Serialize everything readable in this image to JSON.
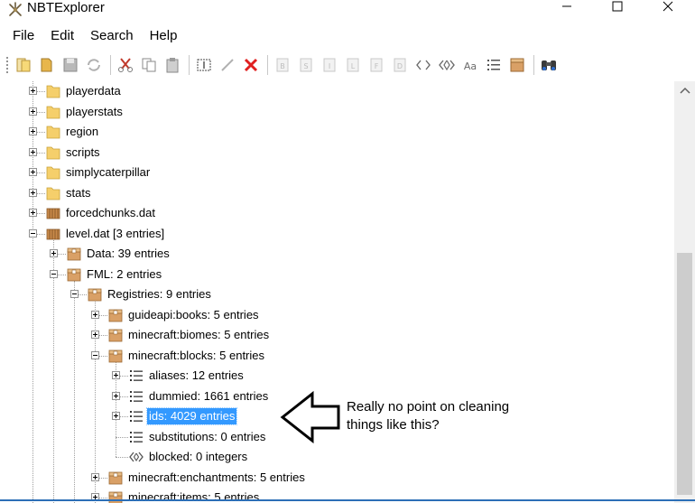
{
  "window": {
    "title": "NBTExplorer"
  },
  "menu": [
    "File",
    "Edit",
    "Search",
    "Help"
  ],
  "toolbar_icons": [
    "open-folder-icon",
    "open-file-icon",
    "save-icon",
    "refresh-icon",
    "cut-icon",
    "copy-icon",
    "paste-icon",
    "rename-icon",
    "edit-icon",
    "delete-icon",
    "add-byte-icon",
    "add-short-icon",
    "add-int-icon",
    "add-long-icon",
    "add-float-icon",
    "add-double-icon",
    "add-byte-array-icon",
    "add-int-array-icon",
    "add-string-icon",
    "add-list-icon",
    "add-compound-icon",
    "find-icon"
  ],
  "tree": [
    {
      "label": "playerdata",
      "icon": "folder-icon",
      "depth": 0,
      "expander": "plus"
    },
    {
      "label": "playerstats",
      "icon": "folder-icon",
      "depth": 0,
      "expander": "plus"
    },
    {
      "label": "region",
      "icon": "folder-icon",
      "depth": 0,
      "expander": "plus"
    },
    {
      "label": "scripts",
      "icon": "folder-icon",
      "depth": 0,
      "expander": "plus"
    },
    {
      "label": "simplycaterpillar",
      "icon": "folder-icon",
      "depth": 0,
      "expander": "plus"
    },
    {
      "label": "stats",
      "icon": "folder-icon",
      "depth": 0,
      "expander": "plus"
    },
    {
      "label": "forcedchunks.dat",
      "icon": "dat-file-icon",
      "depth": 0,
      "expander": "plus"
    },
    {
      "label": "level.dat [3 entries]",
      "icon": "dat-file-icon",
      "depth": 0,
      "expander": "minus"
    },
    {
      "label": "Data: 39 entries",
      "icon": "compound-tag-icon",
      "depth": 1,
      "expander": "plus"
    },
    {
      "label": "FML: 2 entries",
      "icon": "compound-tag-icon",
      "depth": 1,
      "expander": "minus"
    },
    {
      "label": "Registries: 9 entries",
      "icon": "compound-tag-icon",
      "depth": 2,
      "expander": "minus"
    },
    {
      "label": "guideapi:books: 5 entries",
      "icon": "compound-tag-icon",
      "depth": 3,
      "expander": "plus"
    },
    {
      "label": "minecraft:biomes: 5 entries",
      "icon": "compound-tag-icon",
      "depth": 3,
      "expander": "plus"
    },
    {
      "label": "minecraft:blocks: 5 entries",
      "icon": "compound-tag-icon",
      "depth": 3,
      "expander": "minus"
    },
    {
      "label": "aliases: 12 entries",
      "icon": "list-tag-icon",
      "depth": 4,
      "expander": "plus"
    },
    {
      "label": "dummied: 1661 entries",
      "icon": "list-tag-icon",
      "depth": 4,
      "expander": "plus"
    },
    {
      "label": "ids: 4029 entries",
      "icon": "list-tag-icon",
      "depth": 4,
      "expander": "plus",
      "selected": true
    },
    {
      "label": "substitutions: 0 entries",
      "icon": "list-tag-icon",
      "depth": 4,
      "expander": "none"
    },
    {
      "label": "blocked: 0 integers",
      "icon": "int-array-tag-icon",
      "depth": 4,
      "expander": "none"
    },
    {
      "label": "minecraft:enchantments: 5 entries",
      "icon": "compound-tag-icon",
      "depth": 3,
      "expander": "plus"
    },
    {
      "label": "minecraft:items: 5 entries",
      "icon": "compound-tag-icon",
      "depth": 3,
      "expander": "plus"
    }
  ],
  "annotation": {
    "text": "Really no point on cleaning things like this?"
  },
  "colors": {
    "selection": "#3399ff",
    "folder": "#f5cf6b",
    "compound": "#d9a066",
    "accent": "#2c6fb7"
  }
}
